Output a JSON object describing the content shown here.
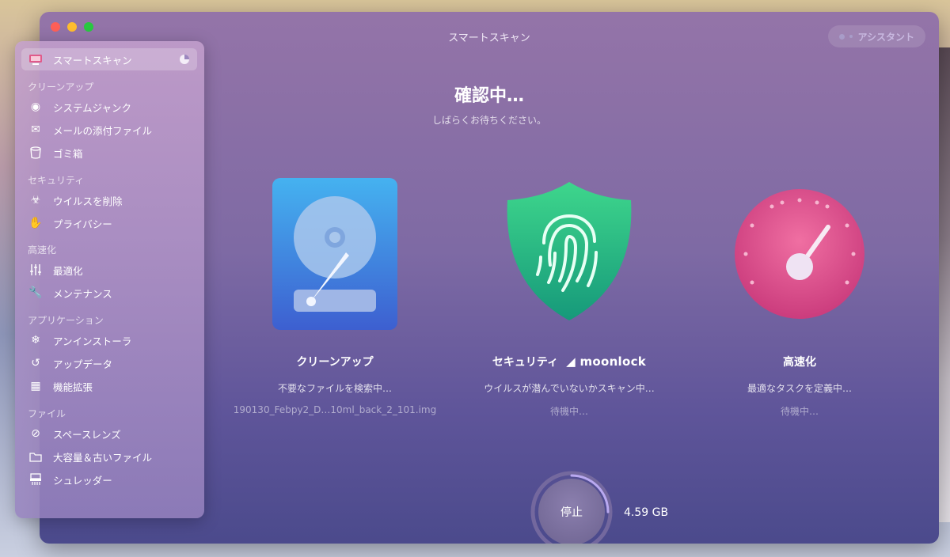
{
  "window": {
    "title": "スマートスキャン",
    "assistant_label": "アシスタント"
  },
  "sidebar": {
    "active_item": {
      "label": "スマートスキャン",
      "icon": "monitor-icon"
    },
    "sections": [
      {
        "header": "クリーンアップ",
        "items": [
          {
            "label": "システムジャンク",
            "icon": "disk-icon"
          },
          {
            "label": "メールの添付ファイル",
            "icon": "mail-icon"
          },
          {
            "label": "ゴミ箱",
            "icon": "trash-icon"
          }
        ]
      },
      {
        "header": "セキュリティ",
        "items": [
          {
            "label": "ウイルスを削除",
            "icon": "biohazard-icon"
          },
          {
            "label": "プライバシー",
            "icon": "hand-icon"
          }
        ]
      },
      {
        "header": "高速化",
        "items": [
          {
            "label": "最適化",
            "icon": "sliders-icon"
          },
          {
            "label": "メンテナンス",
            "icon": "wrench-icon"
          }
        ]
      },
      {
        "header": "アプリケーション",
        "items": [
          {
            "label": "アンインストーラ",
            "icon": "uninstall-icon"
          },
          {
            "label": "アップデータ",
            "icon": "update-icon"
          },
          {
            "label": "機能拡張",
            "icon": "puzzle-icon"
          }
        ]
      },
      {
        "header": "ファイル",
        "items": [
          {
            "label": "スペースレンズ",
            "icon": "lens-icon"
          },
          {
            "label": "大容量＆古いファイル",
            "icon": "folder-icon"
          },
          {
            "label": "シュレッダー",
            "icon": "shredder-icon"
          }
        ]
      }
    ]
  },
  "status": {
    "title": "確認中…",
    "subtitle": "しばらくお待ちください。"
  },
  "modules": [
    {
      "name": "クリーンアップ",
      "desc": "不要なファイルを検索中…",
      "detail": "190130_Febpy2_D…10ml_back_2_101.img",
      "icon": "hard-drive-icon"
    },
    {
      "name": "セキュリティ",
      "brand": "moonlock",
      "desc": "ウイルスが潜んでいないかスキャン中…",
      "detail": "待機中…",
      "icon": "fingerprint-shield-icon"
    },
    {
      "name": "高速化",
      "desc": "最適なタスクを定義中…",
      "detail": "待機中…",
      "icon": "speedometer-icon"
    }
  ],
  "footer": {
    "stop_label": "停止",
    "size": "4.59 GB",
    "progress": 0.25
  },
  "colors": {
    "accent_pink": "#e0457f",
    "shield_green": "#2fbf7a",
    "drive_blue": "#3b8fe0"
  }
}
